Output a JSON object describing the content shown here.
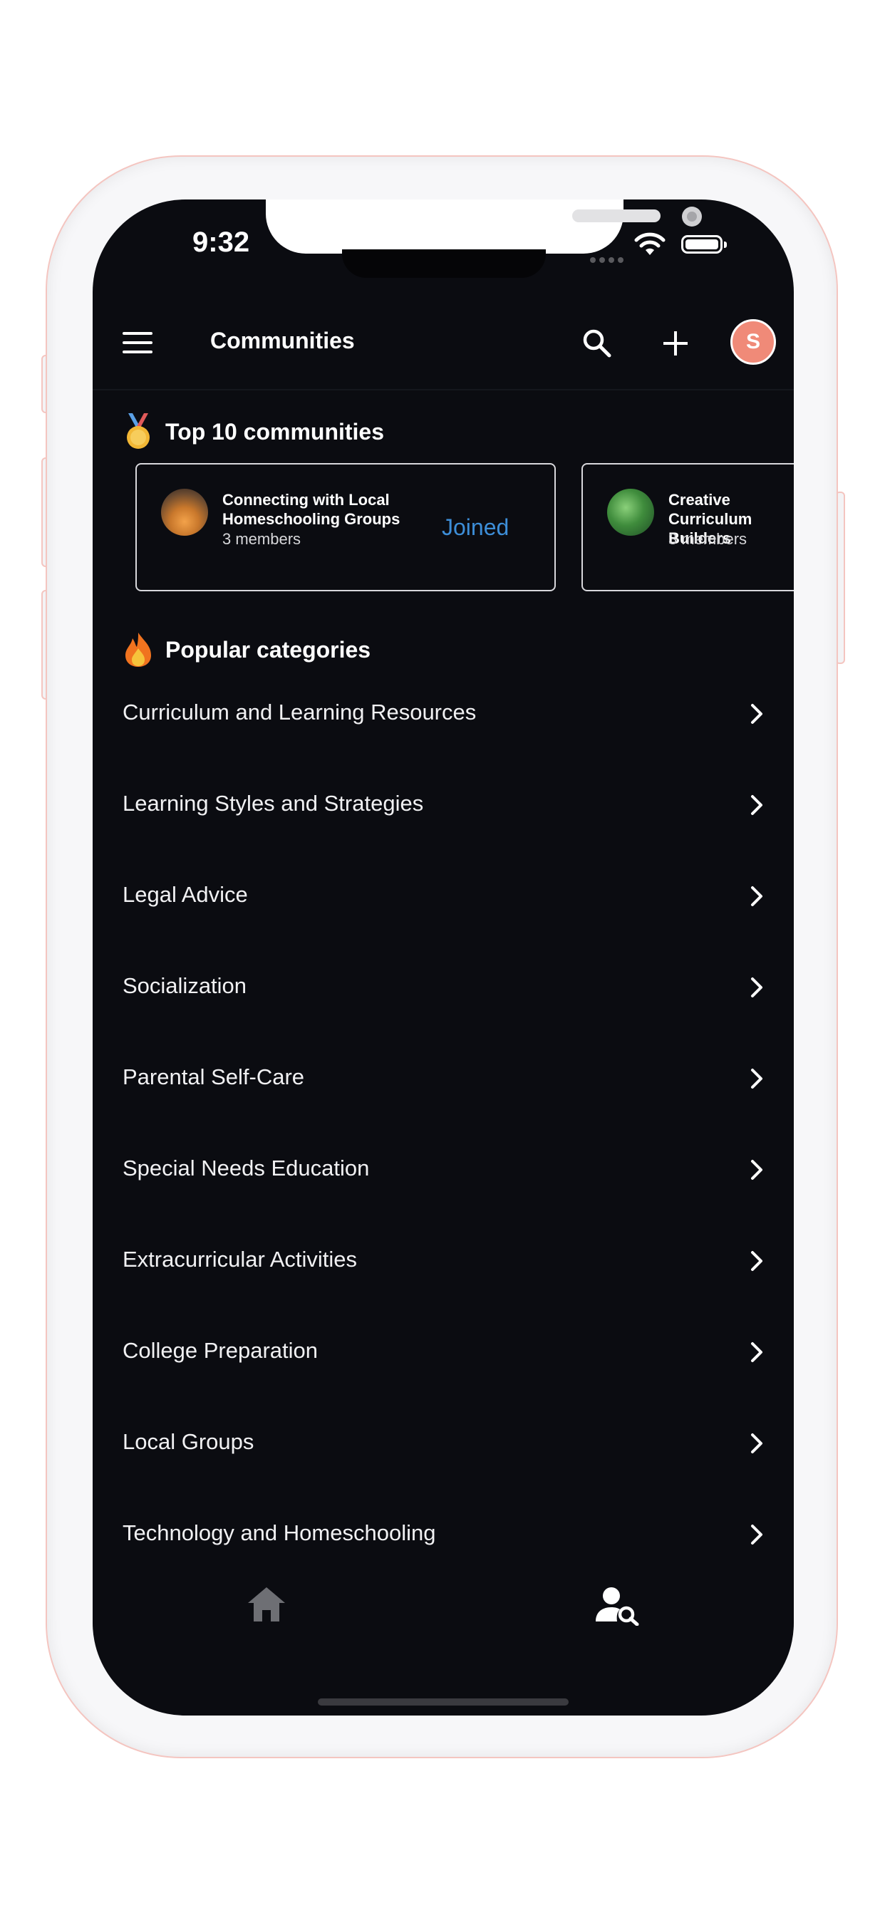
{
  "status_bar": {
    "time": "9:32"
  },
  "app_bar": {
    "title": "Communities",
    "avatar_letter": "S"
  },
  "top_communities": {
    "heading": "Top 10 communities",
    "cards": [
      {
        "name": "Connecting with Local Homeschooling Groups",
        "members": "3 members",
        "status": "Joined"
      },
      {
        "name": "Creative Curriculum Builders",
        "members": "3 members"
      }
    ]
  },
  "popular_categories": {
    "heading": "Popular categories",
    "items": [
      "Curriculum and Learning Resources",
      "Learning Styles and Strategies",
      "Legal Advice",
      "Socialization",
      "Parental Self-Care",
      "Special Needs Education",
      "Extracurricular Activities",
      "College Preparation",
      "Local Groups",
      "Technology and Homeschooling"
    ]
  },
  "bottom_nav": {
    "items": [
      "home-icon",
      "profile-search-icon"
    ],
    "active": "profile-search-icon"
  },
  "colors": {
    "background": "#0b0c11",
    "accent": "#3d8ed8",
    "avatar": "#f08a78"
  }
}
